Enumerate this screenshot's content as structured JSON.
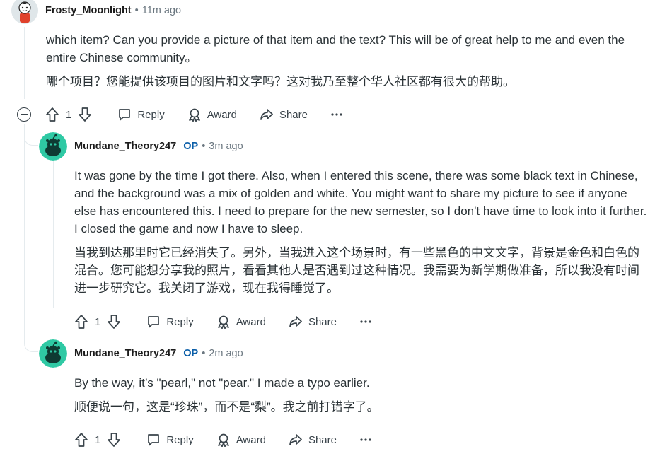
{
  "comments": [
    {
      "username": "Frosty_Moonlight",
      "op_label": "",
      "time": "11m ago",
      "paragraphs": [
        "which item?  Can you provide a picture of that item and the text?  This will be of great help to me and even the entire Chinese community。",
        "哪个项目？您能提供该项目的图片和文字吗？这对我乃至整个华人社区都有很大的帮助。"
      ],
      "votes": "1"
    },
    {
      "username": "Mundane_Theory247",
      "op_label": "OP",
      "time": "3m ago",
      "paragraphs": [
        "It was gone by the time I got there. Also, when I entered this scene, there was some black text in Chinese, and the background was a mix of golden and white. You might want to share my picture to see if anyone else has encountered this. I need to prepare for the new semester, so I don't have time to look into it further. I closed the game and now I have to sleep.",
        "当我到达那里时它已经消失了。另外，当我进入这个场景时，有一些黑色的中文文字，背景是金色和白色的混合。您可能想分享我的照片，看看其他人是否遇到过这种情况。我需要为新学期做准备，所以我没有时间进一步研究它。我关闭了游戏，现在我得睡觉了。"
      ],
      "votes": "1"
    },
    {
      "username": "Mundane_Theory247",
      "op_label": "OP",
      "time": "2m ago",
      "paragraphs": [
        "By the way, it’s \"pearl,\" not \"pear.\" I made a typo earlier.",
        "顺便说一句，这是“珍珠”，而不是“梨”。我之前打错字了。"
      ],
      "votes": "1"
    }
  ],
  "actions": {
    "reply": "Reply",
    "award": "Award",
    "share": "Share"
  },
  "colors": {
    "op": "#0a5ea8",
    "avatar_teal": "#2fc9a4",
    "thread_line": "#e5ebee"
  },
  "icons": [
    "upvote-icon",
    "downvote-icon",
    "reply-icon",
    "award-icon",
    "share-icon",
    "more-icon",
    "collapse-icon"
  ]
}
